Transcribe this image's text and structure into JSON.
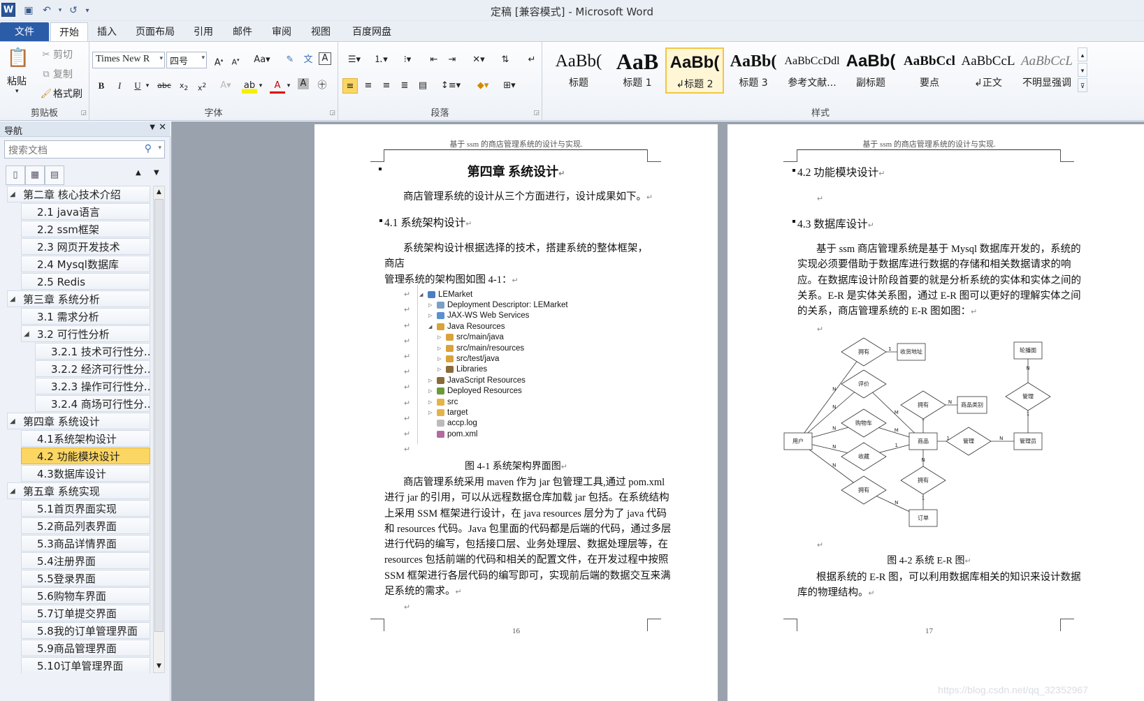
{
  "window": {
    "title": "定稿 [兼容模式] - Microsoft Word",
    "logo": "W"
  },
  "quick_access": [
    {
      "icon": "save-icon",
      "glyph": "💾"
    },
    {
      "icon": "undo-icon",
      "glyph": "↶"
    },
    {
      "icon": "redo-icon",
      "glyph": "↺"
    },
    {
      "icon": "customize-icon",
      "glyph": "▾"
    }
  ],
  "tabs": [
    {
      "label": "文件"
    },
    {
      "label": "开始"
    },
    {
      "label": "插入"
    },
    {
      "label": "页面布局"
    },
    {
      "label": "引用"
    },
    {
      "label": "邮件"
    },
    {
      "label": "审阅"
    },
    {
      "label": "视图"
    },
    {
      "label": "百度网盘"
    }
  ],
  "clipboard": {
    "paste": "粘贴",
    "cut": "剪切",
    "copy": "复制",
    "format_painter": "格式刷",
    "label": "剪贴板"
  },
  "font": {
    "name": "Times New R",
    "size": "四号",
    "label": "字体"
  },
  "paragraph": {
    "label": "段落"
  },
  "styles": {
    "label": "样式",
    "items": [
      {
        "sample": "AaBb(",
        "name": "标题"
      },
      {
        "sample": "AaB",
        "name": "标题 1"
      },
      {
        "sample": "AaBb(",
        "name": "↲标题 2"
      },
      {
        "sample": "AaBb(",
        "name": "标题 3"
      },
      {
        "sample": "AaBbCcDdl",
        "name": "参考文献..."
      },
      {
        "sample": "AaBb(",
        "name": "副标题"
      },
      {
        "sample": "AaBbCcl",
        "name": "要点"
      },
      {
        "sample": "AaBbCcL",
        "name": "↲正文"
      },
      {
        "sample": "AaBbCcL",
        "name": "不明显强调"
      }
    ]
  },
  "nav": {
    "title": "导航",
    "search_placeholder": "搜索文档",
    "items": [
      {
        "label": "第二章 核心技术介绍",
        "level": 1,
        "expander": "◢"
      },
      {
        "label": "2.1 java语言",
        "level": 2
      },
      {
        "label": "2.2 ssm框架",
        "level": 2
      },
      {
        "label": "2.3 网页开发技术",
        "level": 2
      },
      {
        "label": "2.4 Mysql数据库",
        "level": 2
      },
      {
        "label": "2.5 Redis",
        "level": 2
      },
      {
        "label": "第三章 系统分析",
        "level": 1,
        "expander": "◢"
      },
      {
        "label": "3.1 需求分析",
        "level": 2
      },
      {
        "label": "3.2 可行性分析",
        "level": 2,
        "expander": "◢"
      },
      {
        "label": "3.2.1 技术可行性分...",
        "level": 3
      },
      {
        "label": "3.2.2 经济可行性分...",
        "level": 3
      },
      {
        "label": "3.2.3 操作可行性分...",
        "level": 3
      },
      {
        "label": "3.2.4 商场可行性分...",
        "level": 3
      },
      {
        "label": "第四章 系统设计",
        "level": 1,
        "expander": "◢"
      },
      {
        "label": "4.1系统架构设计",
        "level": 2
      },
      {
        "label": "4.2 功能模块设计",
        "level": 2,
        "selected": true
      },
      {
        "label": "4.3数据库设计",
        "level": 2
      },
      {
        "label": "第五章 系统实现",
        "level": 1,
        "expander": "◢"
      },
      {
        "label": "5.1首页界面实现",
        "level": 2
      },
      {
        "label": "5.2商品列表界面",
        "level": 2
      },
      {
        "label": "5.3商品详情界面",
        "level": 2
      },
      {
        "label": "5.4注册界面",
        "level": 2
      },
      {
        "label": "5.5登录界面",
        "level": 2
      },
      {
        "label": "5.6购物车界面",
        "level": 2
      },
      {
        "label": "5.7订单提交界面",
        "level": 2
      },
      {
        "label": "5.8我的订单管理界面",
        "level": 2
      },
      {
        "label": "5.9商品管理界面",
        "level": 2
      },
      {
        "label": "5.10订单管理界面",
        "level": 2
      }
    ]
  },
  "page1": {
    "header": "基于 ssm 的商店管理系统的设计与实现.",
    "chapter": "第四章  系统设计",
    "intro": "商店管理系统的设计从三个方面进行，设计成果如下。",
    "h41": "4.1 系统架构设计",
    "p1a": "系统架构设计根据选择的技术，搭建系统的整体框架，商店",
    "p1b": "管理系统的架构图如图 4-1：",
    "tree": [
      {
        "label": "LEMarket",
        "indent": 0,
        "arrow": "◢",
        "color": "#4a7fc1"
      },
      {
        "label": "Deployment Descriptor: LEMarket",
        "indent": 1,
        "arrow": "▷",
        "color": "#7aa0c8"
      },
      {
        "label": "JAX-WS Web Services",
        "indent": 1,
        "arrow": "▷",
        "color": "#5b8fd0"
      },
      {
        "label": "Java Resources",
        "indent": 1,
        "arrow": "◢",
        "color": "#d9a23a"
      },
      {
        "label": "src/main/java",
        "indent": 2,
        "arrow": "▷",
        "color": "#d9a23a"
      },
      {
        "label": "src/main/resources",
        "indent": 2,
        "arrow": "▷",
        "color": "#d9a23a"
      },
      {
        "label": "src/test/java",
        "indent": 2,
        "arrow": "▷",
        "color": "#d9a23a"
      },
      {
        "label": "Libraries",
        "indent": 2,
        "arrow": "▷",
        "color": "#8a6b3a"
      },
      {
        "label": "JavaScript Resources",
        "indent": 1,
        "arrow": "▷",
        "color": "#8a6b3a"
      },
      {
        "label": "Deployed Resources",
        "indent": 1,
        "arrow": "▷",
        "color": "#6a9a3a"
      },
      {
        "label": "src",
        "indent": 1,
        "arrow": "▷",
        "color": "#e3b44a"
      },
      {
        "label": "target",
        "indent": 1,
        "arrow": "▷",
        "color": "#e3b44a"
      },
      {
        "label": "accp.log",
        "indent": 1,
        "arrow": "",
        "color": "#bbbbbb"
      },
      {
        "label": "pom.xml",
        "indent": 1,
        "arrow": "",
        "color": "#b46aa0"
      }
    ],
    "caption": "图 4-1    系统架构界面图",
    "p2": [
      "商店管理系统采用 maven 作为 jar 包管理工具,通过 pom.xml",
      "进行 jar 的引用，可以从远程数据仓库加载 jar 包括。在系统结构",
      "上采用 SSM 框架进行设计，在 java resources 层分为了 java 代码",
      "和 resources 代码。Java 包里面的代码都是后端的代码，通过多层",
      "进行代码的编写，包括接口层、业务处理层、数据处理层等，在",
      "resources 包括前端的代码和相关的配置文件，在开发过程中按照",
      "SSM 框架进行各层代码的编写即可，实现前后端的数据交互来满",
      "足系统的需求。"
    ],
    "page_number": "16"
  },
  "page2": {
    "header": "基于 ssm 的商店管理系统的设计与实现.",
    "h42": "4.2  功能模块设计",
    "h43": "4.3 数据库设计",
    "p1": [
      "基于 ssm 商店管理系统是基于 Mysql 数据库开发的，系统的",
      "实现必须要借助于数据库进行数据的存储和相关数据请求的响",
      "应。在数据库设计阶段首要的就是分析系统的实体和实体之间的",
      "关系。E-R 是实体关系图，通过 E-R 图可以更好的理解实体之间",
      "的关系，商店管理系统的 E-R 图如图："
    ],
    "er": {
      "entities": [
        "用户",
        "收货地址",
        "商品",
        "商品类别",
        "管理员",
        "轮播图",
        "订单"
      ],
      "relations": [
        "拥有",
        "评价",
        "购物车",
        "收藏",
        "拥有",
        "拥有",
        "管理",
        "管理",
        "拥有"
      ],
      "card": [
        "N",
        "1",
        "N",
        "M",
        "N",
        "M",
        "N",
        "1",
        "N",
        "N",
        "1",
        "N",
        "1",
        "N",
        "1",
        "N",
        "N",
        "1"
      ]
    },
    "caption": "图 4-2    系统 E-R 图",
    "p2": [
      "根据系统的 E-R 图，可以利用数据库相关的知识来设计数据",
      "库的物理结构。"
    ],
    "page_number": "17"
  },
  "watermark": "https://blog.csdn.net/qq_32352967"
}
